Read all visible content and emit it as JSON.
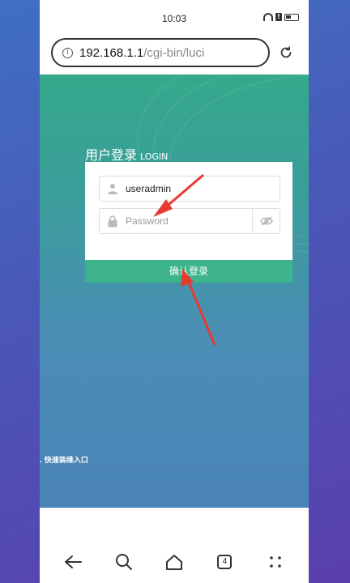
{
  "status_bar": {
    "time": "10:03",
    "icons": [
      "wifi-icon",
      "alert-icon",
      "battery-icon"
    ]
  },
  "browser": {
    "url_host": "192.168.1.1",
    "url_path": "/cgi-bin/luci",
    "info_icon": "ⓘ"
  },
  "login": {
    "title_cn": "用户登录",
    "title_en": "LOGIN",
    "username_value": "useradmin",
    "password_placeholder": "Password",
    "submit_label": "确认登录"
  },
  "quick_link": "I.  快速装维入口",
  "navbar": {
    "tabs_count": "4"
  },
  "colors": {
    "accent_green": "#3db48c",
    "arrow_red": "#e53b30"
  }
}
